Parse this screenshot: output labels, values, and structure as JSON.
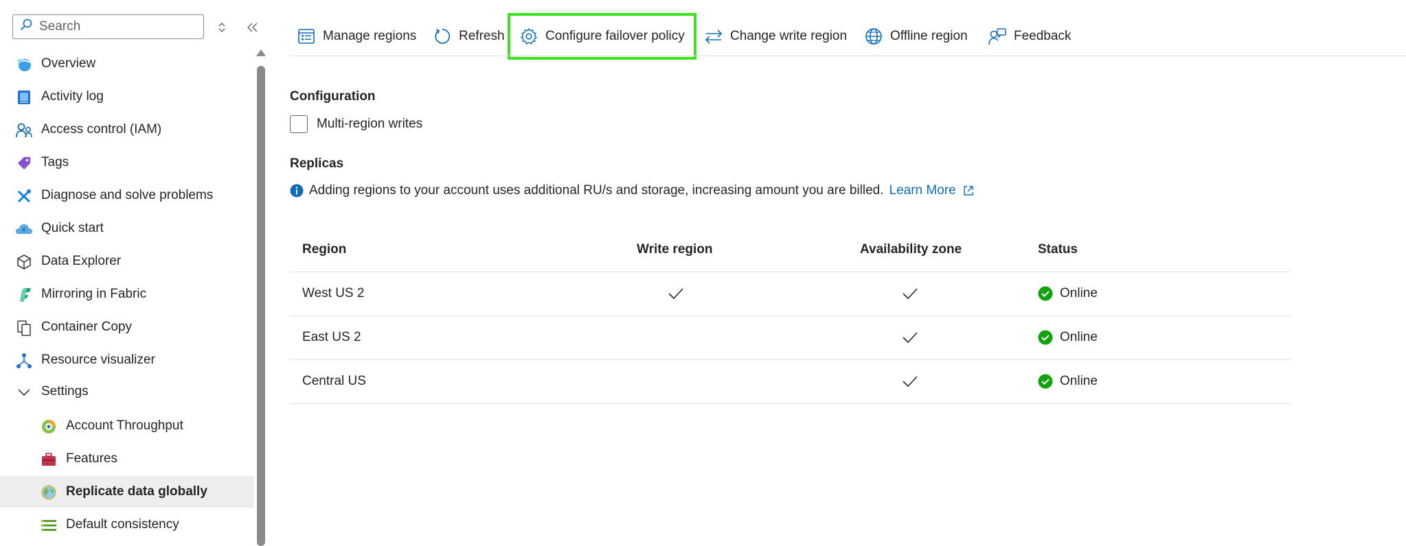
{
  "sidebar": {
    "search_placeholder": "Search",
    "items": [
      {
        "label": "Overview",
        "icon": "overview-icon"
      },
      {
        "label": "Activity log",
        "icon": "activity-log-icon"
      },
      {
        "label": "Access control (IAM)",
        "icon": "access-control-icon"
      },
      {
        "label": "Tags",
        "icon": "tags-icon"
      },
      {
        "label": "Diagnose and solve problems",
        "icon": "diagnose-icon"
      },
      {
        "label": "Quick start",
        "icon": "quick-start-icon"
      },
      {
        "label": "Data Explorer",
        "icon": "data-explorer-icon"
      },
      {
        "label": "Mirroring in Fabric",
        "icon": "fabric-icon"
      },
      {
        "label": "Container Copy",
        "icon": "container-copy-icon"
      },
      {
        "label": "Resource visualizer",
        "icon": "resource-visualizer-icon"
      },
      {
        "label": "Settings",
        "icon": "chevron-down-icon"
      },
      {
        "label": "Account Throughput",
        "icon": "throughput-icon"
      },
      {
        "label": "Features",
        "icon": "features-icon"
      },
      {
        "label": "Replicate data globally",
        "icon": "globe-icon"
      },
      {
        "label": "Default consistency",
        "icon": "consistency-icon"
      }
    ]
  },
  "toolbar": {
    "manage_regions": "Manage regions",
    "refresh": "Refresh",
    "configure_failover": "Configure failover policy",
    "change_write_region": "Change write region",
    "offline_region": "Offline region",
    "feedback": "Feedback"
  },
  "configuration": {
    "title": "Configuration",
    "multi_region_writes_label": "Multi-region writes",
    "multi_region_writes_checked": false
  },
  "replicas": {
    "title": "Replicas",
    "info_text": "Adding regions to your account uses additional RU/s and storage, increasing amount you are billed.",
    "learn_more": "Learn More",
    "columns": [
      "Region",
      "Write region",
      "Availability zone",
      "Status"
    ],
    "rows": [
      {
        "region": "West US 2",
        "write_region": true,
        "availability_zone": true,
        "status": "Online"
      },
      {
        "region": "East US 2",
        "write_region": false,
        "availability_zone": true,
        "status": "Online"
      },
      {
        "region": "Central US",
        "write_region": false,
        "availability_zone": true,
        "status": "Online"
      }
    ]
  },
  "colors": {
    "accent": "#0f6cbd",
    "highlight": "#3ee01f",
    "status_online": "#13a10e"
  }
}
